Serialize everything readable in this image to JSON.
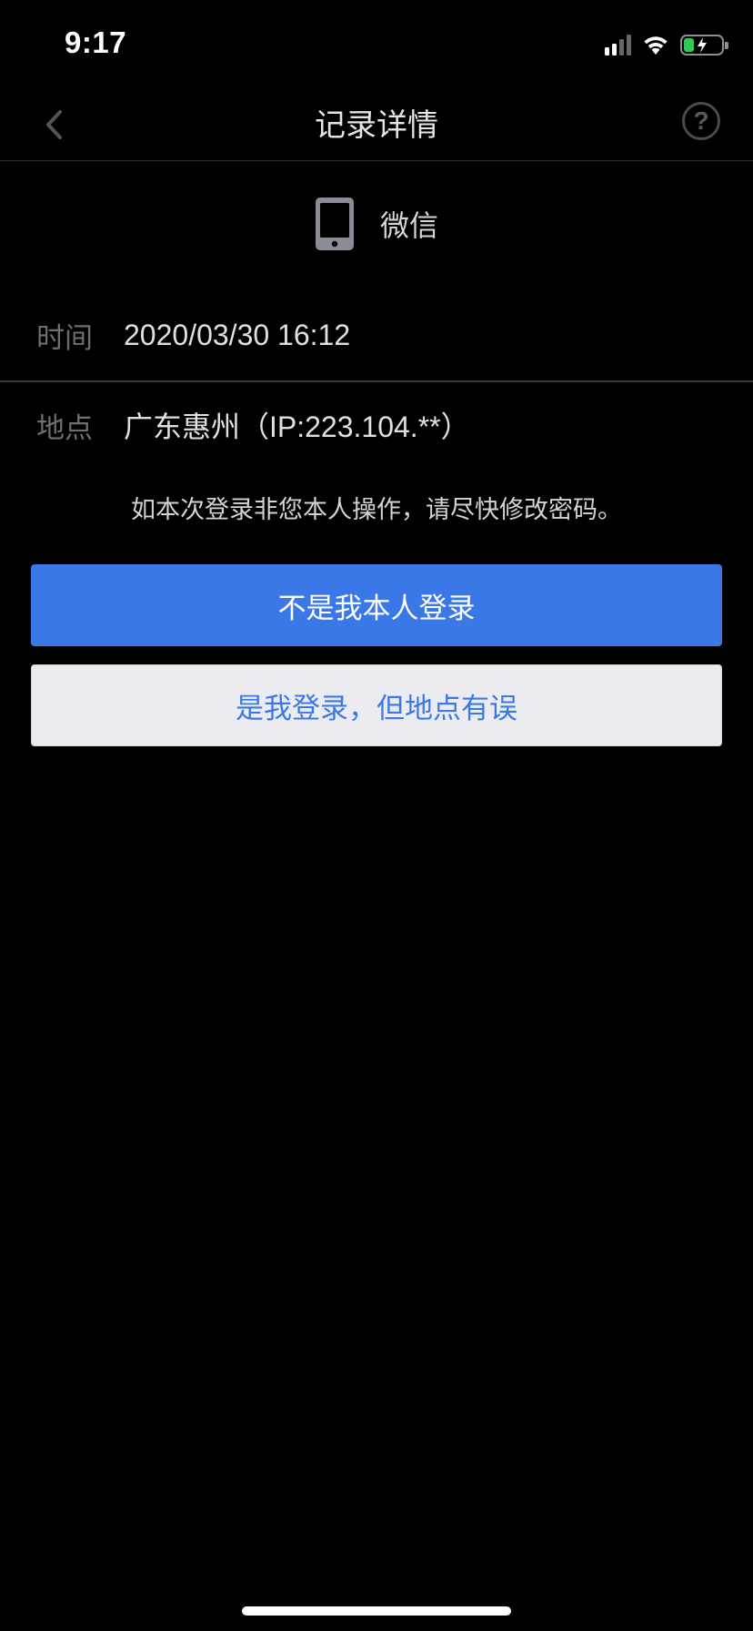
{
  "status_bar": {
    "time": "9:17",
    "icons": [
      "signal-icon",
      "wifi-icon",
      "battery-charging-icon"
    ]
  },
  "nav": {
    "title": "记录详情",
    "back_icon": "chevron-left-icon",
    "help_label": "?"
  },
  "device": {
    "icon": "phone-icon",
    "label": "微信"
  },
  "details": {
    "time_label": "时间",
    "time_value": "2020/03/30 16:12",
    "location_label": "地点",
    "location_value": "广东惠州（IP:223.104.**）"
  },
  "warning_text": "如本次登录非您本人操作，请尽快修改密码。",
  "buttons": {
    "primary_label": "不是我本人登录",
    "secondary_label": "是我登录，但地点有误"
  },
  "colors": {
    "accent": "#3b78e7",
    "background": "#000000",
    "battery": "#34c759"
  }
}
